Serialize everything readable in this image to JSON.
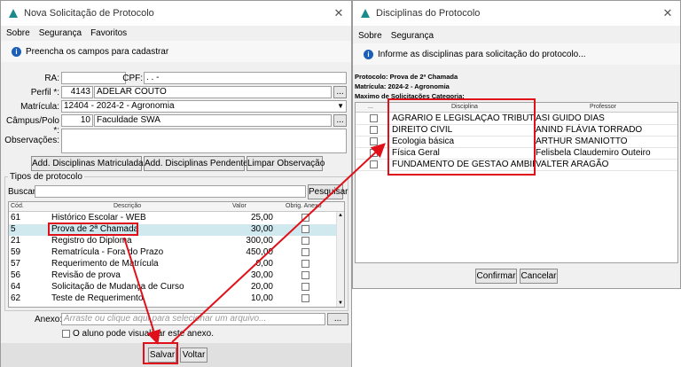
{
  "left_window": {
    "title": "Nova Solicitação de Protocolo",
    "menu": [
      "Sobre",
      "Segurança",
      "Favoritos"
    ],
    "info": "Preencha os campos para cadastrar",
    "fields": {
      "ra_label": "RA:",
      "cpf_label": "CPF:",
      "cpf_value": ".      .      -",
      "perfil_label": "Perfil *:",
      "perfil_code": "4143",
      "perfil_name": "ADELAR COUTO",
      "matricula_label": "Matrícula:",
      "matricula_value": "12404 - 2024-2 - Agronomia",
      "campus_label": "Câmpus/Polo *:",
      "campus_code": "10",
      "campus_name": "Faculdade SWA",
      "obs_label": "Observações:",
      "ellipsis": "..."
    },
    "buttons": {
      "add_matriculadas": "Add. Disciplinas Matriculadas",
      "add_pendentes": "Add. Disciplinas Pendentes",
      "limpar": "Limpar Observação"
    },
    "tipos": {
      "group_title": "Tipos de protocolo",
      "search_label": "Buscar:",
      "search_button": "Pesquisar",
      "columns": [
        "Cód.",
        "Descrição",
        "Valor",
        "Obrig. Anexo"
      ],
      "rows": [
        {
          "cod": "61",
          "desc": "Histórico Escolar - WEB",
          "valor": "25,00"
        },
        {
          "cod": "5",
          "desc": "Prova de 2ª Chamada",
          "valor": "30,00"
        },
        {
          "cod": "21",
          "desc": "Registro do Diploma",
          "valor": "300,00"
        },
        {
          "cod": "59",
          "desc": "Rematrícula - Fora do Prazo",
          "valor": "450,00"
        },
        {
          "cod": "57",
          "desc": "Requerimento de Matrícula",
          "valor": "0,00"
        },
        {
          "cod": "56",
          "desc": "Revisão de prova",
          "valor": "30,00"
        },
        {
          "cod": "64",
          "desc": "Solicitação de Mudança de Curso",
          "valor": "20,00"
        },
        {
          "cod": "62",
          "desc": "Teste de Requerimento",
          "valor": "10,00"
        }
      ]
    },
    "anexo_label": "Anexo:",
    "anexo_placeholder": "Arraste ou clique aqui para selecionar um arquivo...",
    "visualizar_label": "O aluno pode visualizar este anexo.",
    "salvar": "Salvar",
    "voltar": "Voltar"
  },
  "right_window": {
    "title": "Disciplinas do Protocolo",
    "menu": [
      "Sobre",
      "Segurança"
    ],
    "info": "Informe as disciplinas para solicitação do protocolo...",
    "protocolo_line": "Protocolo: Prova de 2ª Chamada",
    "matricula_line": "Matrícula: 2024-2 - Agronomia",
    "maximo_line": "Maximo de Solicitações Categoria:",
    "columns": [
      "...",
      "Disciplina",
      "Professor"
    ],
    "rows": [
      {
        "disciplina": "AGRÁRIO E LEGISLAÇÃO TRIBUTÁRIA",
        "professor": "ASI GUIDO DIAS"
      },
      {
        "disciplina": "DIREITO CIVIL",
        "professor": "ANIND FLÁVIA TORRADO"
      },
      {
        "disciplina": "Ecologia básica",
        "professor": "ARTHUR SMANIOTTO"
      },
      {
        "disciplina": "Física Geral",
        "professor": "Felisbela Claudemiro Outeiro"
      },
      {
        "disciplina": "FUNDAMENTO DE GESTÃO AMBIENT...",
        "professor": "VALTER ARAGÃO"
      }
    ],
    "confirmar": "Confirmar",
    "cancelar": "Cancelar"
  },
  "colors": {
    "highlight_row": "#cfe9ee",
    "annotation_red": "#e0101a",
    "logo_teal": "#1a8a8a"
  }
}
